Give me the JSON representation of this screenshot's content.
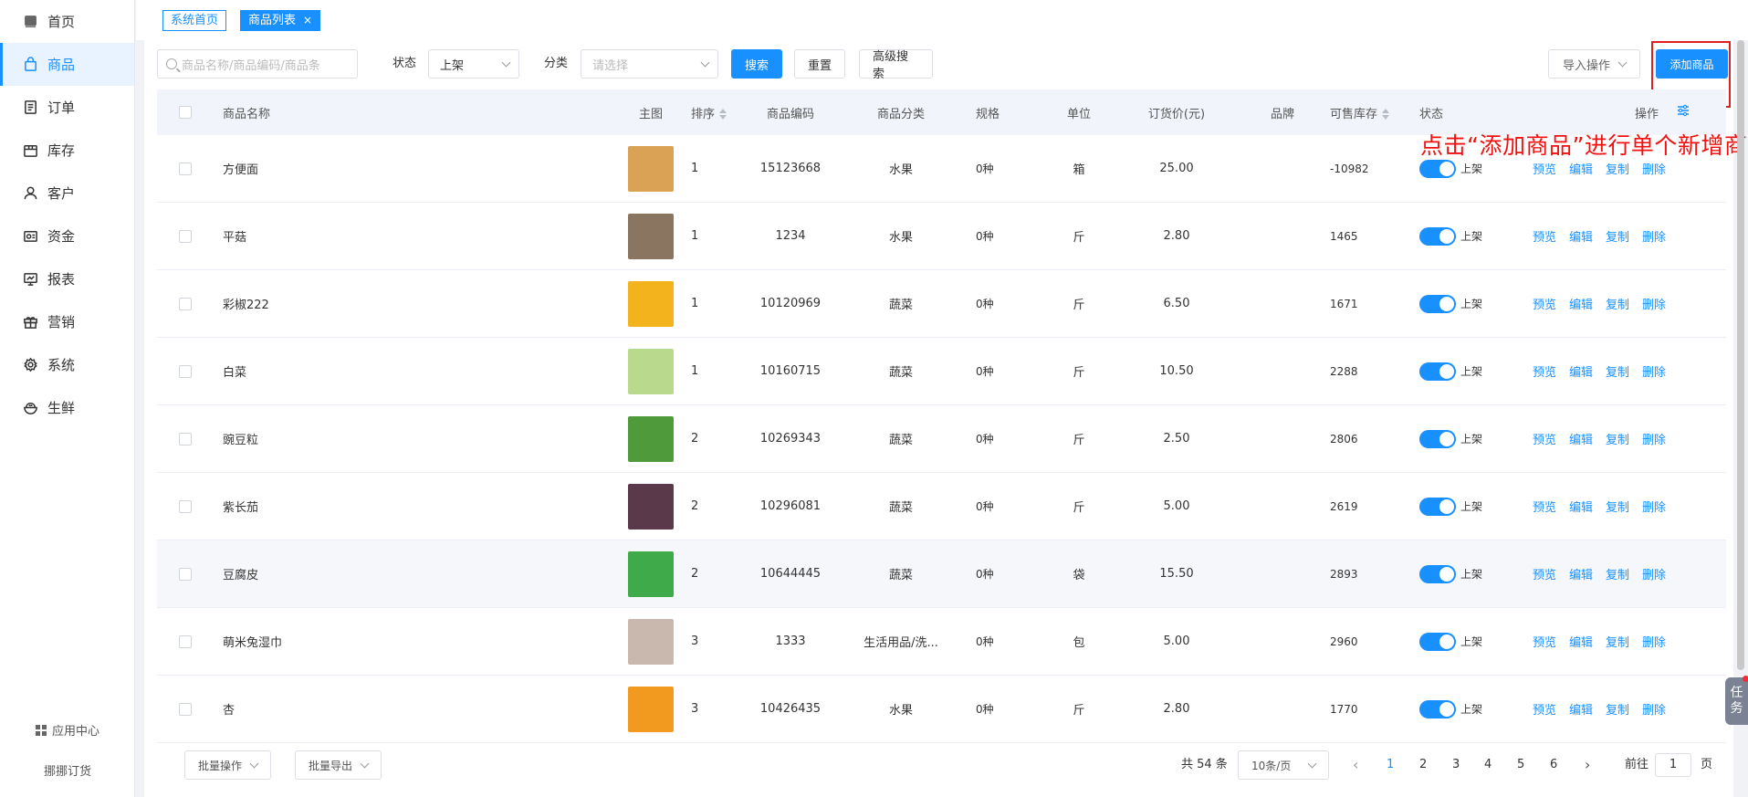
{
  "sidebar": {
    "items": [
      {
        "label": "首页",
        "icon": "home-icon"
      },
      {
        "label": "商品",
        "icon": "bag-icon",
        "active": true
      },
      {
        "label": "订单",
        "icon": "order-icon"
      },
      {
        "label": "库存",
        "icon": "box-icon"
      },
      {
        "label": "客户",
        "icon": "user-icon"
      },
      {
        "label": "资金",
        "icon": "wallet-icon"
      },
      {
        "label": "报表",
        "icon": "chart-icon"
      },
      {
        "label": "营销",
        "icon": "gift-icon"
      },
      {
        "label": "系统",
        "icon": "gear-icon"
      },
      {
        "label": "生鲜",
        "icon": "bowl-icon"
      }
    ],
    "app_center": "应用中心",
    "brand": "挪挪订货"
  },
  "tags": {
    "home": "系统首页",
    "current": "商品列表",
    "close": "×"
  },
  "filter": {
    "search_placeholder": "商品名称/商品编码/商品条",
    "status_label": "状态",
    "status_value": "上架",
    "category_label": "分类",
    "category_placeholder": "请选择",
    "search_btn": "搜索",
    "reset_btn": "重置",
    "advanced_btn": "高级搜索",
    "import_btn": "导入操作",
    "add_btn": "添加商品"
  },
  "annotation": "点击“添加商品”进行单个新增商品",
  "table": {
    "headers": {
      "name": "商品名称",
      "img": "主图",
      "sort": "排序",
      "code": "商品编码",
      "category": "商品分类",
      "spec": "规格",
      "unit": "单位",
      "price": "订货价(元)",
      "brand": "品牌",
      "stock": "可售库存",
      "status": "状态",
      "ops": "操作"
    },
    "ops": {
      "preview": "预览",
      "edit": "编辑",
      "copy": "复制",
      "delete": "删除"
    },
    "rows": [
      {
        "name": "方便面",
        "sort": "1",
        "code": "15123668",
        "category": "水果",
        "spec": "0种",
        "unit": "箱",
        "price": "25.00",
        "brand": "",
        "stock": "-10982",
        "status": "上架",
        "thumb_color": "#d9a255"
      },
      {
        "name": "平菇",
        "sort": "1",
        "code": "1234",
        "category": "水果",
        "spec": "0种",
        "unit": "斤",
        "price": "2.80",
        "brand": "",
        "stock": "1465",
        "status": "上架",
        "thumb_color": "#8a7560"
      },
      {
        "name": "彩椒222",
        "sort": "1",
        "code": "10120969",
        "category": "蔬菜",
        "spec": "0种",
        "unit": "斤",
        "price": "6.50",
        "brand": "",
        "stock": "1671",
        "status": "上架",
        "thumb_color": "#f3b31c"
      },
      {
        "name": "白菜",
        "sort": "1",
        "code": "10160715",
        "category": "蔬菜",
        "spec": "0种",
        "unit": "斤",
        "price": "10.50",
        "brand": "",
        "stock": "2288",
        "status": "上架",
        "thumb_color": "#b9d98c"
      },
      {
        "name": "豌豆粒",
        "sort": "2",
        "code": "10269343",
        "category": "蔬菜",
        "spec": "0种",
        "unit": "斤",
        "price": "2.50",
        "brand": "",
        "stock": "2806",
        "status": "上架",
        "thumb_color": "#4f9a3a"
      },
      {
        "name": "紫长茄",
        "sort": "2",
        "code": "10296081",
        "category": "蔬菜",
        "spec": "0种",
        "unit": "斤",
        "price": "5.00",
        "brand": "",
        "stock": "2619",
        "status": "上架",
        "thumb_color": "#5a3a4a"
      },
      {
        "name": "豆腐皮",
        "sort": "2",
        "code": "10644445",
        "category": "蔬菜",
        "spec": "0种",
        "unit": "袋",
        "price": "15.50",
        "brand": "",
        "stock": "2893",
        "status": "上架",
        "thumb_color": "#3faa4a",
        "highlight": true
      },
      {
        "name": "萌米兔湿巾",
        "sort": "3",
        "code": "1333",
        "category": "生活用品/洗...",
        "spec": "0种",
        "unit": "包",
        "price": "5.00",
        "brand": "",
        "stock": "2960",
        "status": "上架",
        "thumb_color": "#c9b8ae"
      },
      {
        "name": "杏",
        "sort": "3",
        "code": "10426435",
        "category": "水果",
        "spec": "0种",
        "unit": "斤",
        "price": "2.80",
        "brand": "",
        "stock": "1770",
        "status": "上架",
        "thumb_color": "#f29a1f"
      }
    ]
  },
  "footer": {
    "batch_ops": "批量操作",
    "batch_export": "批量导出",
    "total": "共 54 条",
    "page_size": "10条/页",
    "pages": [
      "1",
      "2",
      "3",
      "4",
      "5",
      "6"
    ],
    "current_page": "1",
    "goto_label": "前往",
    "goto_value": "1",
    "page_unit": "页"
  },
  "float_task": {
    "line1": "任",
    "line2": "务"
  },
  "colors": {
    "primary": "#1890ff",
    "annotation": "#f01010",
    "highlight_box": "#e02020"
  }
}
